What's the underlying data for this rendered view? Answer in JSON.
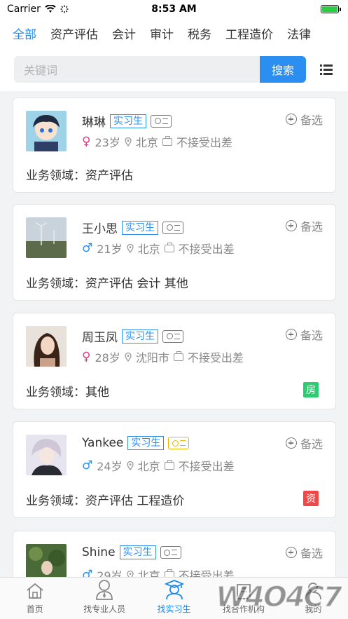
{
  "status_bar": {
    "carrier": "Carrier",
    "time": "8:53 AM"
  },
  "category_tabs": [
    "全部",
    "资产评估",
    "会计",
    "审计",
    "税务",
    "工程造价",
    "法律"
  ],
  "search": {
    "placeholder": "关键词",
    "button_label": "搜索"
  },
  "cards": [
    {
      "name": "琳琳",
      "tag": "实习生",
      "gender": "♀",
      "age": "23岁",
      "city": "北京",
      "travel": "不接受出差",
      "backup": "备选",
      "field": "业务领域：资产评估",
      "badge": ""
    },
    {
      "name": "王小思",
      "tag": "实习生",
      "gender": "♂",
      "age": "21岁",
      "city": "北京",
      "travel": "不接受出差",
      "backup": "备选",
      "field": "业务领域：资产评估 会计 其他",
      "badge": ""
    },
    {
      "name": "周玉凤",
      "tag": "实习生",
      "gender": "♀",
      "age": "28岁",
      "city": "沈阳市",
      "travel": "不接受出差",
      "backup": "备选",
      "field": "业务领域：其他",
      "badge": "房"
    },
    {
      "name": "Yankee",
      "tag": "实习生",
      "gender": "♂",
      "age": "24岁",
      "city": "北京",
      "travel": "不接受出差",
      "backup": "备选",
      "field": "业务领域：资产评估 工程造价",
      "badge": "资"
    },
    {
      "name": "Shine",
      "tag": "实习生",
      "gender": "♂",
      "age": "29岁",
      "city": "北京",
      "travel": "不接受出差",
      "backup": "备选",
      "field": "",
      "badge": ""
    }
  ],
  "tabbar": [
    "首页",
    "找专业人员",
    "找实习生",
    "找合作机构",
    "我的"
  ],
  "watermark": "W4O4C7",
  "colors": {
    "accent": "#1a8cf0",
    "badge_green": "#2ecc71",
    "badge_red": "#f04848",
    "cert_gold": "#e8b800"
  }
}
